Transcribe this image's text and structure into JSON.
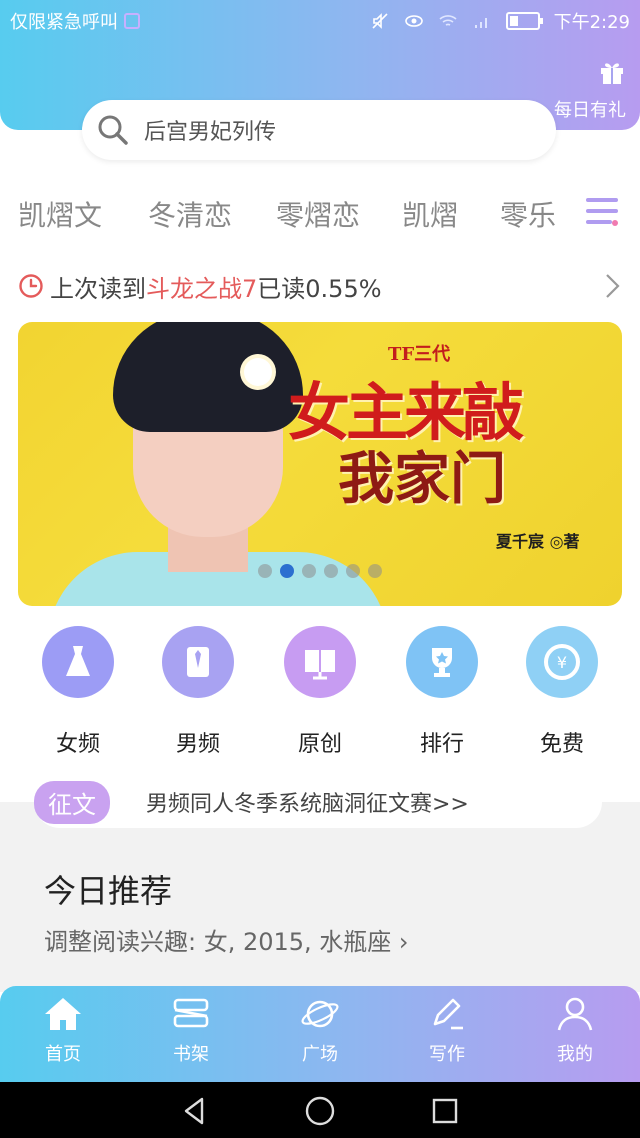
{
  "status_bar": {
    "left_text": "仅限紧急呼叫",
    "time": "下午2:29"
  },
  "gift": {
    "label": "每日有礼",
    "icon": "gift-icon"
  },
  "search": {
    "value": "后宫男妃列传",
    "icon": "search-icon"
  },
  "tags": [
    "凯熠文",
    "冬清恋",
    "零熠恋",
    "凯熠",
    "零乐"
  ],
  "last_read": {
    "prefix": "上次读到",
    "book": "斗龙之战7",
    "suffix": "已读0.55%"
  },
  "banner": {
    "series": "TF三代",
    "title_line1": "女主来敲",
    "title_line2": "我家门",
    "author": "夏千宸 ◎著",
    "dot_count": 6,
    "active_index": 1
  },
  "categories": [
    {
      "label": "女频",
      "icon": "dress-icon",
      "color": "#9c9cf5"
    },
    {
      "label": "男频",
      "icon": "shirt-icon",
      "color": "#a8a2f2"
    },
    {
      "label": "原创",
      "icon": "book-icon",
      "color": "#c79cf2"
    },
    {
      "label": "排行",
      "icon": "trophy-icon",
      "color": "#7fc3f5"
    },
    {
      "label": "免费",
      "icon": "yuan-icon",
      "color": "#8fd0f5"
    }
  ],
  "contest": {
    "badge": "征文",
    "text": "男频同人冬季系统脑洞征文赛>>"
  },
  "recommend": {
    "title": "今日推荐",
    "subtitle": "调整阅读兴趣: 女, 2015, 水瓶座 ›"
  },
  "tabs": [
    {
      "label": "首页",
      "icon": "home-icon"
    },
    {
      "label": "书架",
      "icon": "bookshelf-icon"
    },
    {
      "label": "广场",
      "icon": "planet-icon"
    },
    {
      "label": "写作",
      "icon": "pen-icon"
    },
    {
      "label": "我的",
      "icon": "user-icon"
    }
  ],
  "colors": {
    "header_start": "#57ccef",
    "header_end": "#b79cf0",
    "highlight": "#e45b5b",
    "badge": "#c9a2f0"
  }
}
